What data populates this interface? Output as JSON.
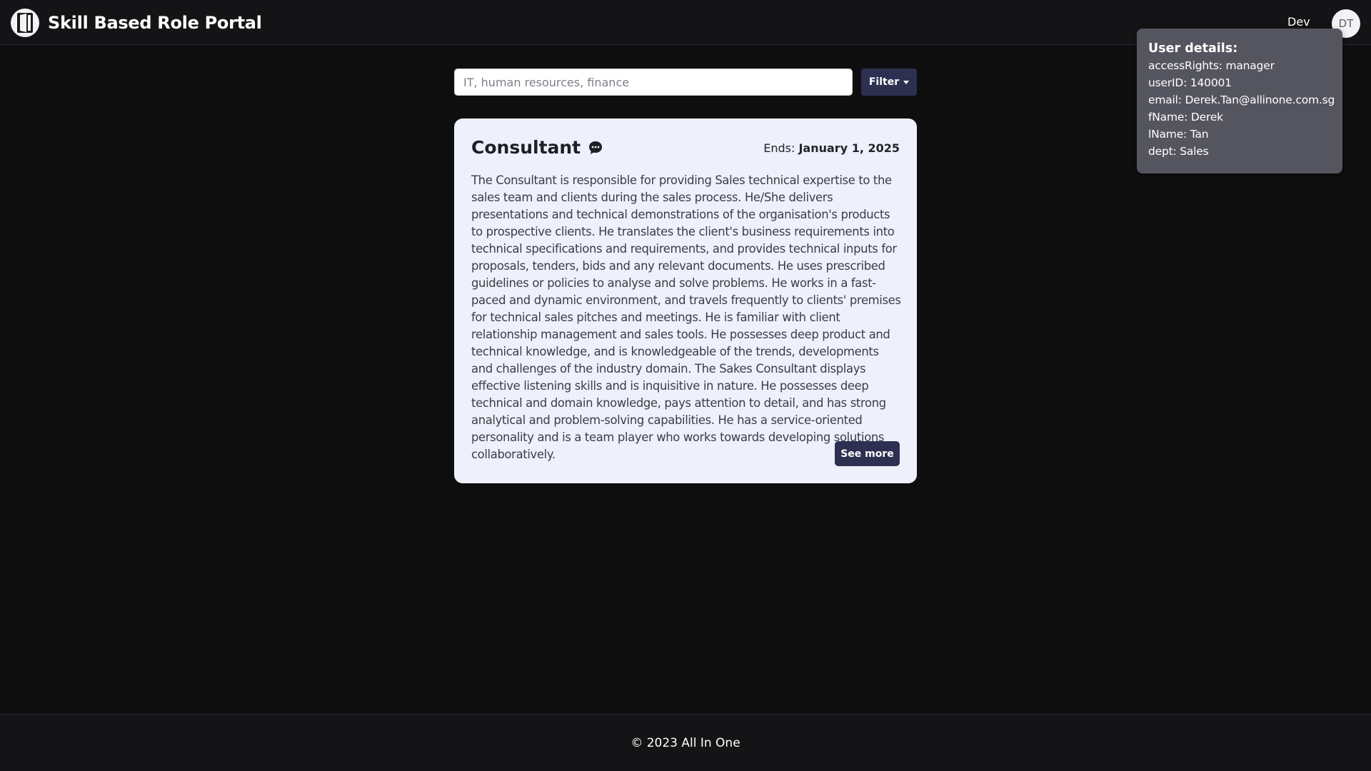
{
  "navbar": {
    "brand_title": "Skill Based Role Portal",
    "brand_icon": "door-logo-icon",
    "nav_link": "Dev",
    "avatar_initials": "DT"
  },
  "user_popover": {
    "title": "User details:",
    "lines": [
      "accessRights: manager",
      "userID: 140001",
      "email: Derek.Tan@allinone.com.sg",
      "fName: Derek",
      "lName: Tan",
      "dept: Sales"
    ]
  },
  "search": {
    "placeholder": "IT, human resources, finance",
    "value": "",
    "filter_label": "Filter"
  },
  "role_card": {
    "title": "Consultant",
    "title_icon": "chat-bubble-icon",
    "ends_label": "Ends:",
    "ends_date": "January 1, 2025",
    "description": "The Consultant is responsible for providing Sales technical expertise to the sales team and clients during the sales process. He/She delivers presentations and technical demonstrations of the organisation's products to prospective clients. He translates the client's business requirements into technical specifications and requirements, and provides technical inputs for proposals, tenders, bids and any relevant documents. He uses prescribed guidelines or policies to analyse and solve problems. He works in a fast-paced and dynamic environment, and travels frequently to clients' premises for technical sales pitches and meetings. He is familiar with client relationship management and sales tools. He possesses deep product and technical knowledge, and is knowledgeable of the trends, developments and challenges of the industry domain. The Sakes Consultant displays effective listening skills and is inquisitive in nature. He possesses deep technical and domain knowledge, pays attention to detail, and has strong analytical and problem-solving capabilities. He has a service-oriented personality and is a team player who works towards developing solutions collaboratively.",
    "see_more_label": "See more"
  },
  "footer": {
    "text": "© 2023 All In One"
  },
  "colors": {
    "background": "#0e0e0f",
    "navbar": "#141416",
    "card": "#eef1fb",
    "button": "#2d3050",
    "popover": "#54555f"
  }
}
